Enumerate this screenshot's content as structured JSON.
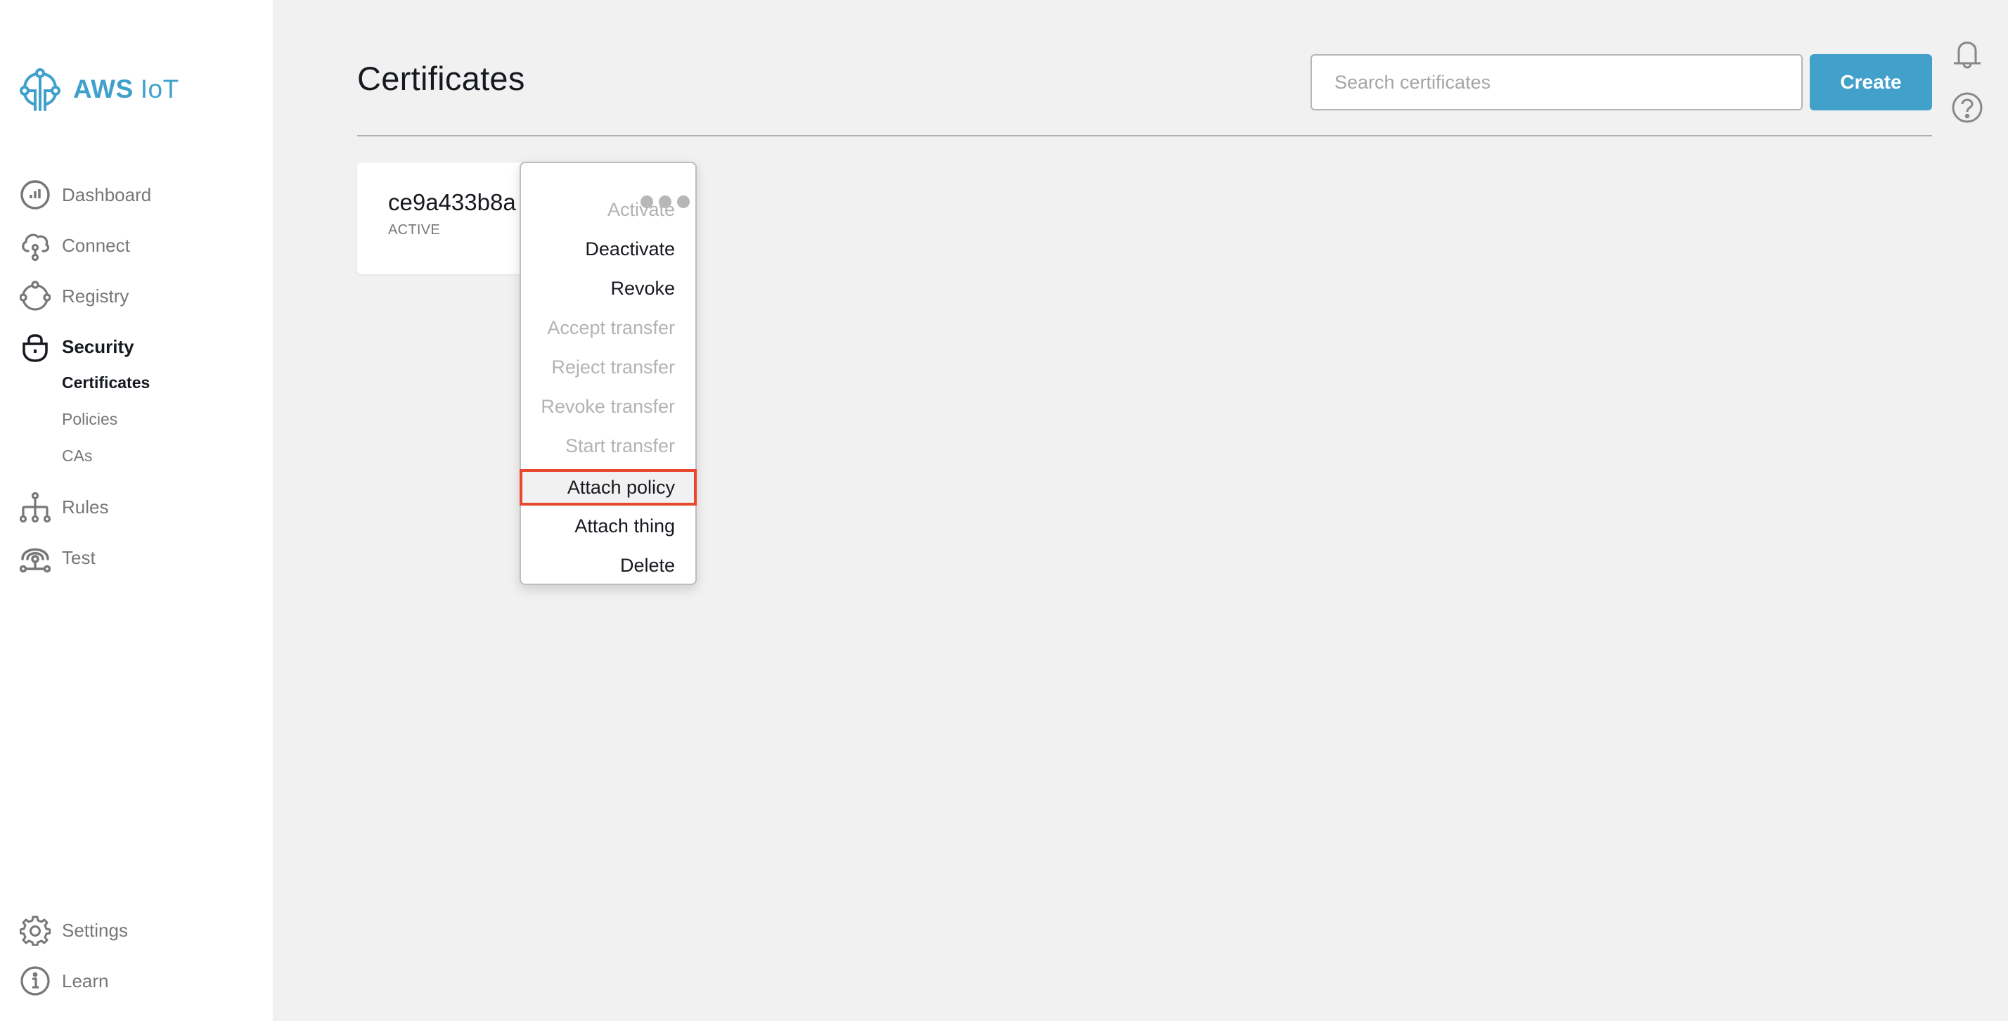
{
  "app": {
    "logo_bold": "AWS",
    "logo_light": "IoT",
    "brand_color": "#3fa1cb"
  },
  "sidebar": {
    "items": [
      {
        "label": "Dashboard",
        "icon": "dashboard-icon"
      },
      {
        "label": "Connect",
        "icon": "cloud-connect-icon"
      },
      {
        "label": "Registry",
        "icon": "registry-icon"
      },
      {
        "label": "Security",
        "icon": "lock-icon",
        "active": true
      },
      {
        "label": "Rules",
        "icon": "rules-icon"
      },
      {
        "label": "Test",
        "icon": "test-signal-icon"
      }
    ],
    "security_subitems": [
      {
        "label": "Certificates",
        "active": true
      },
      {
        "label": "Policies"
      },
      {
        "label": "CAs"
      }
    ],
    "footer_items": [
      {
        "label": "Settings",
        "icon": "gear-icon"
      },
      {
        "label": "Learn",
        "icon": "info-icon"
      }
    ]
  },
  "header": {
    "title": "Certificates",
    "search_placeholder": "Search certificates",
    "search_value": "",
    "create_label": "Create",
    "create_color": "#41a1cb",
    "icons": [
      "bell-icon",
      "help-icon"
    ]
  },
  "certificates": [
    {
      "id": "ce9a433b8a",
      "status": "ACTIVE"
    }
  ],
  "context_menu": {
    "trigger_icon": "more-options-icon",
    "items": [
      {
        "label": "Activate",
        "enabled": false
      },
      {
        "label": "Deactivate",
        "enabled": true
      },
      {
        "label": "Revoke",
        "enabled": true
      },
      {
        "label": "Accept transfer",
        "enabled": false
      },
      {
        "label": "Reject transfer",
        "enabled": false
      },
      {
        "label": "Revoke transfer",
        "enabled": false
      },
      {
        "label": "Start transfer",
        "enabled": false
      },
      {
        "label": "Attach policy",
        "enabled": true,
        "highlighted": true
      },
      {
        "label": "Attach thing",
        "enabled": true
      },
      {
        "label": "Delete",
        "enabled": true
      }
    ],
    "highlight_color": "#e8472d"
  }
}
